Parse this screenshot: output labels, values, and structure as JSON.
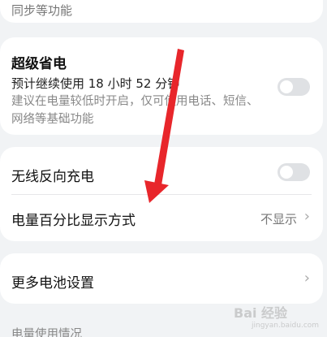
{
  "top_card": {
    "desc": "同步等功能"
  },
  "power_saver": {
    "title": "超级省电",
    "estimate": "预计继续使用 18 小时 52 分钟",
    "description": "建议在电量较低时开启，仅可使用电话、短信、网络等基础功能",
    "enabled": false
  },
  "wireless_reverse": {
    "label": "无线反向充电",
    "enabled": false
  },
  "battery_percent": {
    "label": "电量百分比显示方式",
    "value": "不显示"
  },
  "more_settings": {
    "label": "更多电池设置"
  },
  "usage_section": {
    "title": "电量使用情况"
  },
  "watermark": {
    "text": "Bai 经验",
    "sub": "jingyan.baidu.com"
  },
  "colors": {
    "arrow": "#e8262b",
    "background": "#f1f3f5",
    "card": "#ffffff"
  },
  "icons": {
    "chevron": "chevron-right-icon"
  }
}
